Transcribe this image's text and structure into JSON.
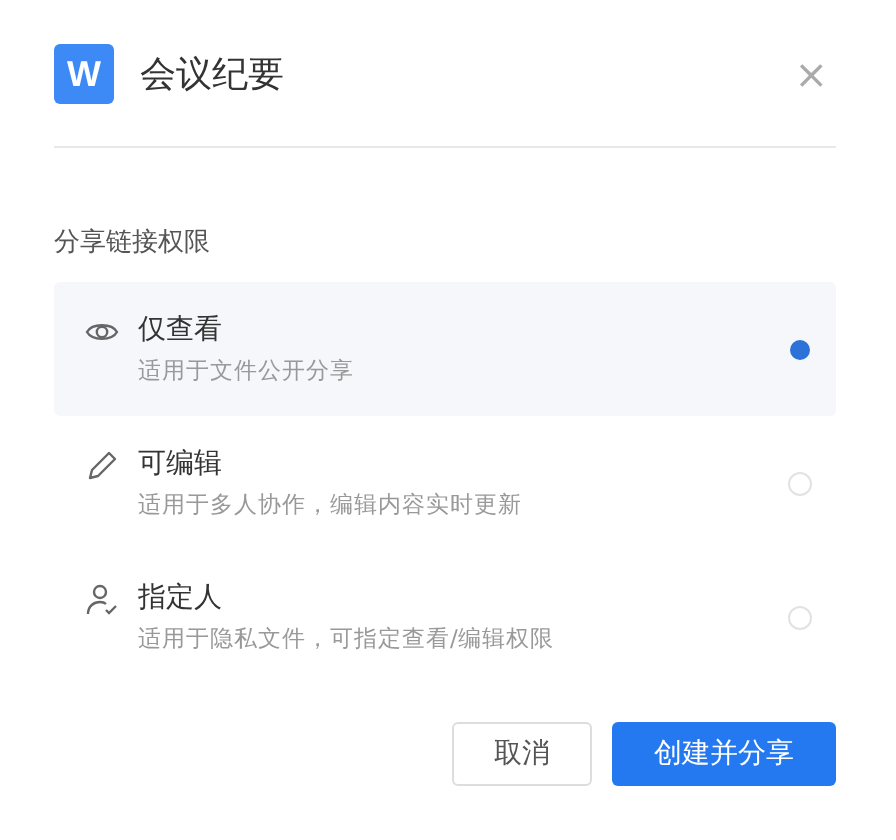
{
  "header": {
    "logo": "W",
    "title": "会议纪要",
    "close": "×"
  },
  "section_label": "分享链接权限",
  "options": [
    {
      "kind": "eye",
      "title": "仅查看",
      "description": "适用于文件公开分享",
      "selected": true
    },
    {
      "kind": "pencil",
      "title": "可编辑",
      "description": "适用于多人协作，编辑内容实时更新",
      "selected": false
    },
    {
      "kind": "person",
      "title": "指定人",
      "description": "适用于隐私文件，可指定查看/编辑权限",
      "selected": false
    }
  ],
  "buttons": [
    {
      "kind": "secondary",
      "label": "取消"
    },
    {
      "kind": "primary",
      "label": "创建并分享"
    }
  ]
}
